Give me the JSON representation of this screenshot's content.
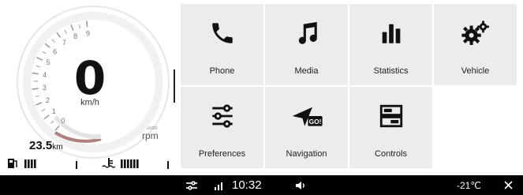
{
  "cluster": {
    "speed_value": "0",
    "speed_unit": "km/h",
    "rpm_multiplier": "x1000",
    "rpm_unit": "rpm",
    "rpm_ticks": [
      "0",
      "1",
      "2",
      "3",
      "4",
      "5",
      "6",
      "7",
      "8",
      "9"
    ],
    "odometer_value": "23.5",
    "odometer_unit": "km",
    "fuel_level": 0.45,
    "coolant_level": 0.55
  },
  "tiles": [
    {
      "label": "Phone",
      "icon": "phone-icon"
    },
    {
      "label": "Media",
      "icon": "music-note-icon"
    },
    {
      "label": "Statistics",
      "icon": "bar-chart-icon"
    },
    {
      "label": "Vehicle",
      "icon": "gears-icon"
    },
    {
      "label": "Preferences",
      "icon": "sliders-icon"
    },
    {
      "label": "Navigation",
      "icon": "navigation-icon",
      "badge": "GO!"
    },
    {
      "label": "Controls",
      "icon": "controls-icon"
    }
  ],
  "statusbar": {
    "time": "10:32",
    "temperature": "-21",
    "temperature_unit": "℃",
    "icons": [
      "settings-sliders-icon",
      "signal-icon",
      "volume-icon",
      "close-icon"
    ]
  },
  "colors": {
    "tile_bg": "#ececec",
    "statusbar_bg": "#000000",
    "rpm_arc": "#b08080"
  }
}
